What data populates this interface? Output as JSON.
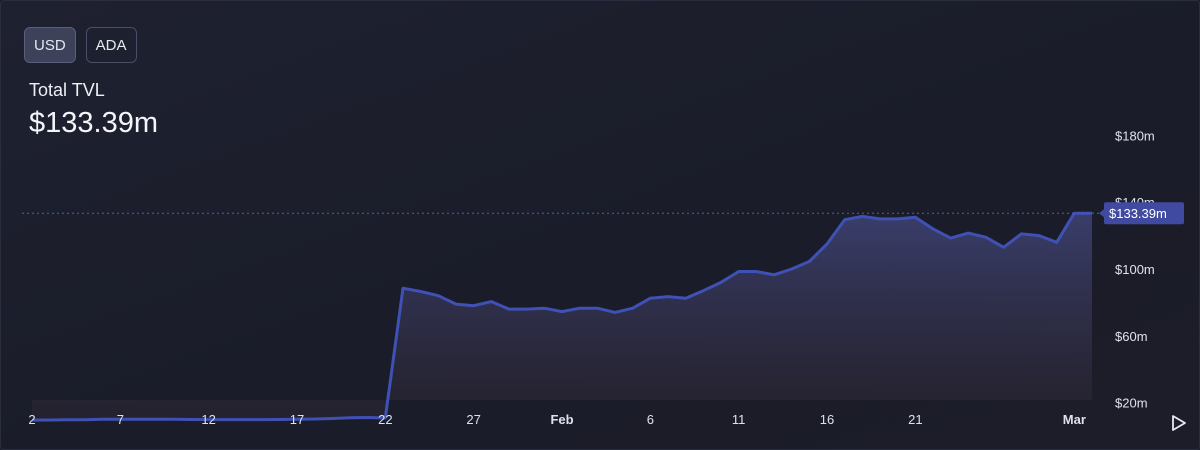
{
  "toggles": {
    "usd_label": "USD",
    "ada_label": "ADA",
    "selected": "USD"
  },
  "summary": {
    "label": "Total TVL",
    "value": "$133.39m"
  },
  "current_price_tag": "$133.39m",
  "colors": {
    "line": "#3f51b5",
    "area_top": "#3b3f6e",
    "area_bottom": "#2a2530",
    "price_tag_bg": "#3f4aa0",
    "axis_text": "#dfe2ec"
  },
  "icons": {
    "play": "play-icon"
  },
  "chart_data": {
    "type": "area",
    "title": "",
    "xlabel": "",
    "ylabel": "",
    "ylim": [
      0,
      200
    ],
    "y_ticks": [
      20,
      60,
      100,
      140,
      180
    ],
    "y_tick_labels": [
      "$20m",
      "$60m",
      "$100m",
      "$140m",
      "$180m"
    ],
    "x_tick_labels": [
      "2",
      "7",
      "12",
      "17",
      "22",
      "27",
      "Feb",
      "6",
      "11",
      "16",
      "21",
      "Mar"
    ],
    "x_tick_index": [
      0,
      5,
      10,
      15,
      20,
      25,
      30,
      35,
      40,
      45,
      50,
      59
    ],
    "grid": false,
    "unit": "$m",
    "series": [
      {
        "values": [
          9.5,
          9.6,
          9.7,
          9.7,
          10.0,
          10.0,
          10.0,
          10.0,
          10.0,
          9.9,
          9.8,
          9.8,
          9.8,
          9.8,
          9.9,
          10.0,
          10.2,
          10.5,
          10.9,
          11.1,
          10.8,
          88.5,
          86.5,
          84.0,
          79.0,
          78.0,
          80.5,
          76.0,
          76.0,
          76.5,
          74.5,
          76.5,
          76.5,
          74.0,
          76.5,
          82.5,
          83.5,
          82.5,
          87.0,
          92.0,
          98.5,
          98.5,
          96.5,
          100.0,
          104.5,
          115.0,
          129.5,
          131.5,
          130.0,
          130.0,
          131.0,
          124.0,
          118.5,
          121.5,
          119.0,
          113.0,
          121.0,
          120.0,
          116.0,
          133.39,
          133.39
        ]
      }
    ]
  },
  "axis_labels": {
    "y": [
      "$20m",
      "$60m",
      "$100m",
      "$140m",
      "$180m"
    ],
    "x": [
      "2",
      "7",
      "12",
      "17",
      "22",
      "27",
      "Feb",
      "6",
      "11",
      "16",
      "21",
      "Mar"
    ]
  }
}
